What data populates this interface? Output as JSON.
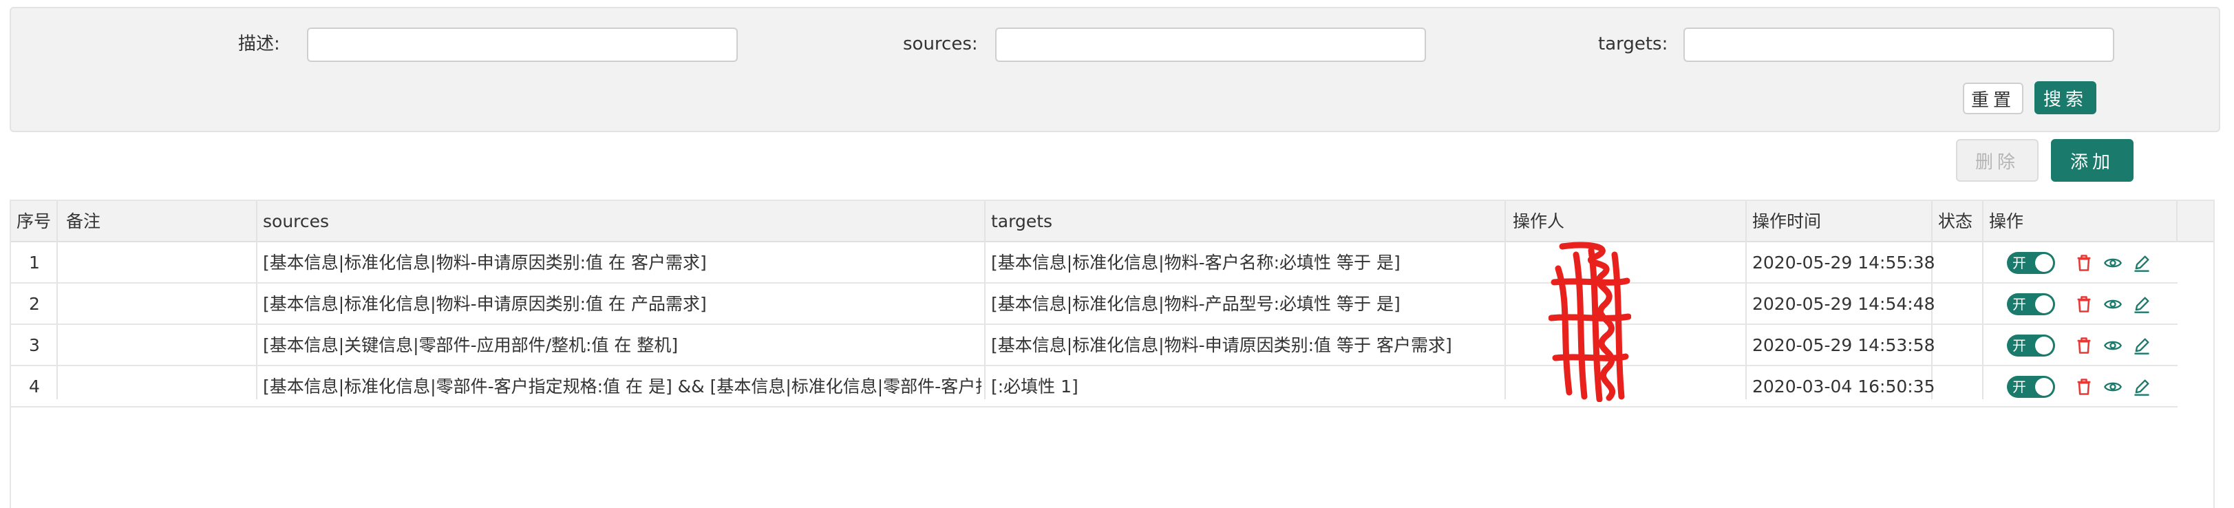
{
  "filters": {
    "desc_label": "描述:",
    "sources_label": "sources:",
    "targets_label": "targets:",
    "desc_value": "",
    "sources_value": "",
    "targets_value": "",
    "reset_label": "重置",
    "search_label": "搜索"
  },
  "toolbar": {
    "delete_label": "删除",
    "add_label": "添加"
  },
  "table": {
    "columns": {
      "index": "序号",
      "remark": "备注",
      "sources": "sources",
      "targets": "targets",
      "operator": "操作人",
      "op_time": "操作时间",
      "status": "状态",
      "actions": "操作"
    },
    "rows": [
      {
        "index": "1",
        "remark": "",
        "sources": "[基本信息|标准化信息|物料-申请原因类别:值 在 客户需求]",
        "targets": "[基本信息|标准化信息|物料-客户名称:必填性 等于 是]",
        "operator": "",
        "op_time": "2020-05-29 14:55:38",
        "status": "开"
      },
      {
        "index": "2",
        "remark": "",
        "sources": "[基本信息|标准化信息|物料-申请原因类别:值 在 产品需求]",
        "targets": "[基本信息|标准化信息|物料-产品型号:必填性 等于 是]",
        "operator": "",
        "op_time": "2020-05-29 14:54:48",
        "status": "开"
      },
      {
        "index": "3",
        "remark": "",
        "sources": "[基本信息|关键信息|零部件-应用部件/整机:值 在 整机]",
        "targets": "[基本信息|标准化信息|物料-申请原因类别:值 等于 客户需求]",
        "operator": "",
        "op_time": "2020-05-29 14:53:58",
        "status": "开"
      },
      {
        "index": "4",
        "remark": "",
        "sources": "[基本信息|标准化信息|零部件-客户指定规格:值 在 是] && [基本信息|标准化信息|零部件-客户指",
        "targets": "[:必填性 1]",
        "operator": "",
        "op_time": "2020-03-04 16:50:35",
        "status": "开"
      }
    ]
  },
  "icons": {
    "delete": "trash-icon",
    "view": "eye-icon",
    "edit": "pencil-icon"
  },
  "colors": {
    "primary": "#1a7a6b",
    "delete_icon": "#e53935",
    "redaction": "#e8211c"
  }
}
